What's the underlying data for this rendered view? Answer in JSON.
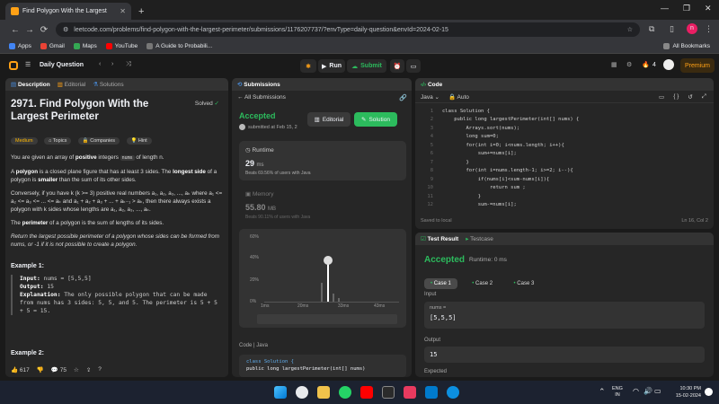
{
  "browser": {
    "tab_title": "Find Polygon With the Largest",
    "tab_close": "✕",
    "new_tab": "+",
    "url": "leetcode.com/problems/find-polygon-with-the-largest-perimeter/submissions/1176207737/?envType=daily-question&envId=2024-02-15",
    "bookmarks": [
      "Apps",
      "Gmail",
      "Maps",
      "YouTube",
      "A Guide to Probabili..."
    ],
    "all_bookmarks": "All Bookmarks"
  },
  "lc": {
    "daily": "Daily Question",
    "run": "Run",
    "submit": "Submit",
    "streak": "4",
    "premium": "Premium"
  },
  "desc": {
    "tabs": [
      "Description",
      "Editorial",
      "Solutions"
    ],
    "title": "2971. Find Polygon With the Largest Perimeter",
    "solved": "Solved",
    "tags": [
      "Medium",
      "Topics",
      "Companies",
      "Hint"
    ],
    "p1_pre": "You are given an array of ",
    "p1_bold": "positive",
    "p1_mid": " integers ",
    "p1_code": "nums",
    "p1_post": " of length n.",
    "p2_pre": "A ",
    "p2_b1": "polygon",
    "p2_mid": " is a closed plane figure that has at least 3 sides. The ",
    "p2_b2": "longest side",
    "p2_mid2": " of a polygon is ",
    "p2_b3": "smaller",
    "p2_post": " than the sum of its other sides.",
    "p3": "Conversely, if you have k (k >= 3) positive real numbers a₁, a₂, a₃, ..., aₖ where a₁ <= a₂ <= a₃ <= ... <= aₖ and a₁ + a₂ + a₃ + ... + aₖ₋₁ > aₖ, then there always exists a polygon with k sides whose lengths are a₁, a₂, a₃, ..., aₖ.",
    "p4_pre": "The ",
    "p4_bold": "perimeter",
    "p4_post": " of a polygon is the sum of lengths of its sides.",
    "p5": "Return the largest possible perimeter of a polygon whose sides can be formed from nums, or -1 if it is not possible to create a polygon.",
    "ex1_title": "Example 1:",
    "ex1_input_label": "Input:",
    "ex1_input": " nums = [5,5,5]",
    "ex1_output_label": "Output:",
    "ex1_output": " 15",
    "ex1_expl_label": "Explanation:",
    "ex1_expl": " The only possible polygon that can be made from nums has 3 sides: 5, 5, and 5. The perimeter is 5 + 5 + 5 = 15.",
    "ex2_title": "Example 2:",
    "likes": "617",
    "comments": "75"
  },
  "subs": {
    "header": "Submissions",
    "all": "All Submissions",
    "status": "Accepted",
    "submitted": "submitted at Feb 15, 2",
    "editorial": "Editorial",
    "solution": "Solution",
    "runtime_label": "Runtime",
    "runtime_val": "29",
    "runtime_unit": "ms",
    "beats_runtime": "Beats 69.56% of users with Java",
    "memory_label": "Memory",
    "memory_val": "55.80",
    "memory_unit": "MB",
    "beats_memory": "Beats 90.11% of users with Java",
    "y_ticks": [
      "60%",
      "40%",
      "20%",
      "0%"
    ],
    "x_ticks": [
      "1ms",
      "20ms",
      "33ms",
      "43ms"
    ],
    "code_lang": "Code | Java",
    "code_l1": "class Solution {",
    "code_l2": "    public long largestPerimeter(int[] nums)"
  },
  "code": {
    "header": "Code",
    "lang": "Java",
    "auto": "Auto",
    "saved": "Saved to local",
    "pos": "Ln 16, Col 2",
    "lines": [
      {
        "n": "1",
        "t": "class Solution {"
      },
      {
        "n": "2",
        "t": "    public long largestPerimeter(int[] nums) {"
      },
      {
        "n": "3",
        "t": "        Arrays.sort(nums);"
      },
      {
        "n": "4",
        "t": "        long sum=0;"
      },
      {
        "n": "5",
        "t": "        for(int i=0; i<nums.length; i++){"
      },
      {
        "n": "6",
        "t": "            sum+=nums[i];"
      },
      {
        "n": "7",
        "t": "        }"
      },
      {
        "n": "8",
        "t": "        for(int i=nums.length-1; i>=2; i--){"
      },
      {
        "n": "9",
        "t": "            if(nums[i]<sum-nums[i]){"
      },
      {
        "n": "10",
        "t": "                return sum ;"
      },
      {
        "n": "11",
        "t": "            }"
      },
      {
        "n": "12",
        "t": "            sum-=nums[i];"
      },
      {
        "n": "13",
        "t": "        }"
      }
    ]
  },
  "result": {
    "tab1": "Test Result",
    "tab2": "Testcase",
    "status": "Accepted",
    "runtime": "Runtime: 0 ms",
    "cases": [
      "Case 1",
      "Case 2",
      "Case 3"
    ],
    "input_label": "Input",
    "param": "nums =",
    "input_val": "[5,5,5]",
    "output_label": "Output",
    "output_val": "15",
    "expected": "Expected"
  },
  "taskbar": {
    "lang1": "ENG",
    "lang2": "IN",
    "time": "10:30 PM",
    "date": "15-02-2024"
  }
}
